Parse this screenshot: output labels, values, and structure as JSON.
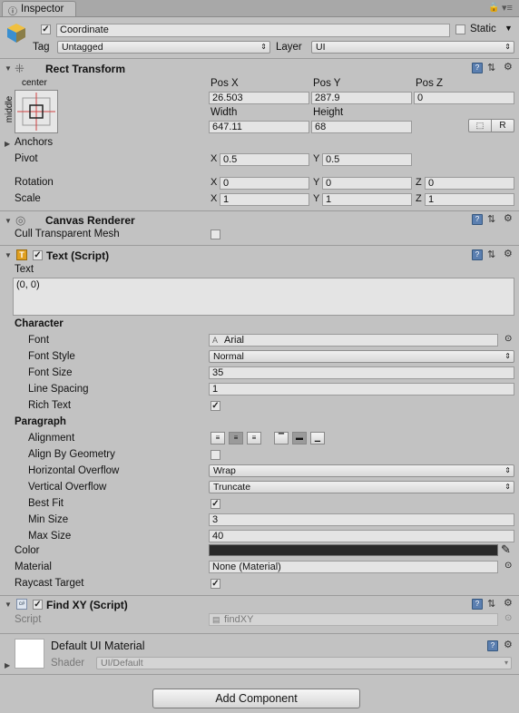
{
  "tab": {
    "title": "Inspector"
  },
  "header": {
    "object_name": "Coordinate",
    "static_label": "Static",
    "tag_label": "Tag",
    "tag_value": "Untagged",
    "layer_label": "Layer",
    "layer_value": "UI"
  },
  "rect_transform": {
    "title": "Rect Transform",
    "anchor_h": "center",
    "anchor_v": "middle",
    "pos_x_label": "Pos X",
    "pos_x": "26.503",
    "pos_y_label": "Pos Y",
    "pos_y": "287.9",
    "pos_z_label": "Pos Z",
    "pos_z": "0",
    "width_label": "Width",
    "width": "647.11",
    "height_label": "Height",
    "height": "68",
    "r_button": "R",
    "anchors_label": "Anchors",
    "pivot_label": "Pivot",
    "pivot_x": "0.5",
    "pivot_y": "0.5",
    "rotation_label": "Rotation",
    "rot_x": "0",
    "rot_y": "0",
    "rot_z": "0",
    "scale_label": "Scale",
    "scale_x": "1",
    "scale_y": "1",
    "scale_z": "1",
    "x": "X",
    "y": "Y",
    "z": "Z"
  },
  "canvas_renderer": {
    "title": "Canvas Renderer",
    "cull_label": "Cull Transparent Mesh"
  },
  "text_script": {
    "title": "Text (Script)",
    "text_label": "Text",
    "text_value": "(0, 0)",
    "character_header": "Character",
    "font_label": "Font",
    "font_value": "Arial",
    "font_style_label": "Font Style",
    "font_style_value": "Normal",
    "font_size_label": "Font Size",
    "font_size_value": "35",
    "line_spacing_label": "Line Spacing",
    "line_spacing_value": "1",
    "rich_text_label": "Rich Text",
    "paragraph_header": "Paragraph",
    "alignment_label": "Alignment",
    "align_geometry_label": "Align By Geometry",
    "h_overflow_label": "Horizontal Overflow",
    "h_overflow_value": "Wrap",
    "v_overflow_label": "Vertical Overflow",
    "v_overflow_value": "Truncate",
    "best_fit_label": "Best Fit",
    "min_size_label": "Min Size",
    "min_size_value": "3",
    "max_size_label": "Max Size",
    "max_size_value": "40",
    "color_label": "Color",
    "color_value": "#2a2a2a",
    "material_label": "Material",
    "material_value": "None (Material)",
    "raycast_label": "Raycast Target"
  },
  "find_xy": {
    "title": "Find XY (Script)",
    "script_label": "Script",
    "script_value": "findXY"
  },
  "material": {
    "name": "Default UI Material",
    "shader_label": "Shader",
    "shader_value": "UI/Default"
  },
  "add_component": "Add Component"
}
